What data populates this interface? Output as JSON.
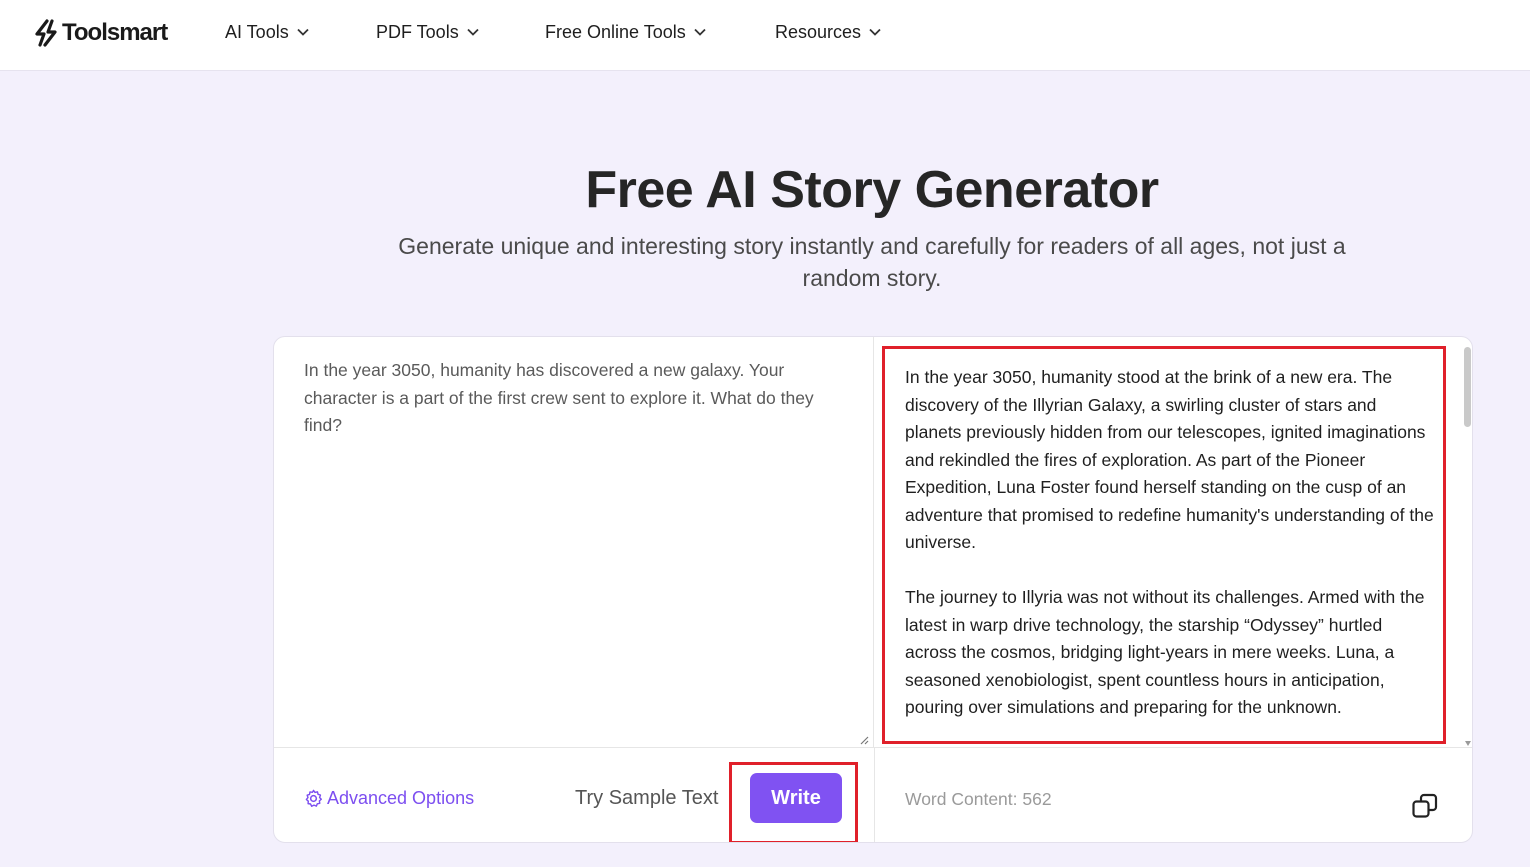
{
  "header": {
    "brand": "Toolsmart",
    "nav": [
      {
        "label": "AI Tools"
      },
      {
        "label": "PDF Tools"
      },
      {
        "label": "Free Online Tools"
      },
      {
        "label": "Resources"
      }
    ]
  },
  "hero": {
    "title": "Free AI Story Generator",
    "subtitle": "Generate unique and interesting story instantly and carefully for readers of all ages, not just a random story."
  },
  "editor": {
    "prompt_text": "In the year 3050, humanity has discovered a new galaxy. Your character is a part of the first crew sent to explore it. What do they find?",
    "output_paragraphs": [
      "In the year 3050, humanity stood at the brink of a new era. The discovery of the Illyrian Galaxy, a swirling cluster of stars and planets previously hidden from our telescopes, ignited imaginations and rekindled the fires of exploration. As part of the Pioneer Expedition, Luna Foster found herself standing on the cusp of an adventure that promised to redefine humanity's understanding of the universe.",
      "The journey to Illyria was not without its challenges. Armed with the latest in warp drive technology, the starship “Odyssey” hurtled across the cosmos, bridging light-years in mere weeks. Luna, a seasoned xenobiologist, spent countless hours in anticipation, pouring over simulations and preparing for the unknown."
    ],
    "advanced_options_label": "Advanced Options",
    "sample_label": "Try Sample Text",
    "write_label": "Write",
    "word_count_label": "Word Content: 562"
  },
  "colors": {
    "accent": "#8052f2",
    "highlight": "#e0202a",
    "background": "#f3f0fc"
  },
  "icons": [
    "toolsmart-logo-icon",
    "chevron-down-icon",
    "gear-icon",
    "copy-icon",
    "resize-grip-icon"
  ]
}
